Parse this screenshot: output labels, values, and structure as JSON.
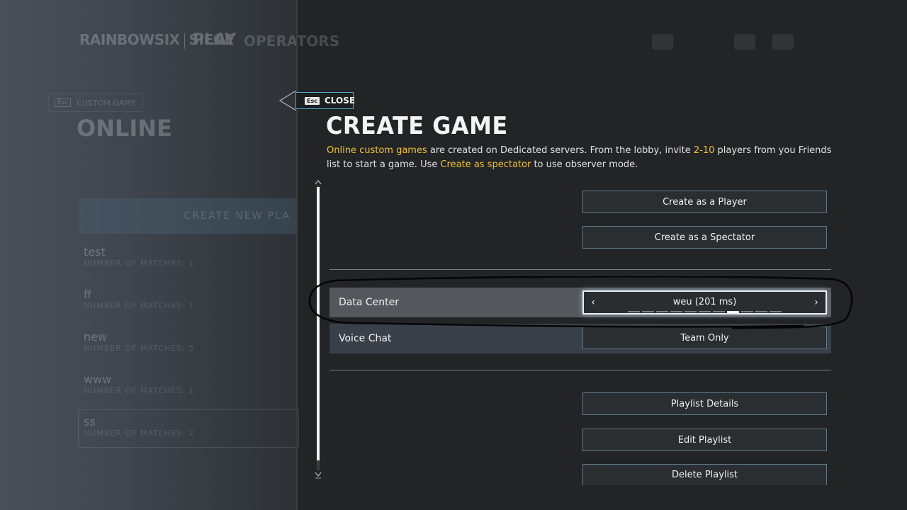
{
  "background": {
    "logo": "RAINBOW SIX | SIEGE",
    "logo_left": "RAINBOWSIX",
    "logo_right": "SIEGE",
    "nav_play": "PLAY",
    "nav_operators": "OPERATORS",
    "esc_key": "Esc",
    "back_label": "CUSTOM GAME",
    "page_title": "ONLINE",
    "create_new_label": "CREATE NEW PLA",
    "playlists": [
      {
        "name": "test",
        "matches": "NUMBER OF MATCHES: 1"
      },
      {
        "name": "ff",
        "matches": "NUMBER OF MATCHES: 1"
      },
      {
        "name": "new",
        "matches": "NUMBER OF MATCHES: 5"
      },
      {
        "name": "www",
        "matches": "NUMBER OF MATCHES: 1"
      },
      {
        "name": "ss",
        "matches": "NUMBER OF MATCHES: 2"
      }
    ]
  },
  "dialog": {
    "close_key": "Esc",
    "close_label": "CLOSE",
    "title": "CREATE GAME",
    "description": {
      "hl1": "Online custom games",
      "t1": " are created on Dedicated servers. From the lobby, invite ",
      "hl2": "2-10",
      "t2": " players from you Friends list to start a game. Use ",
      "hl3": "Create as spectator",
      "t3": " to use observer mode."
    },
    "buttons": {
      "create_player": "Create as a Player",
      "create_spectator": "Create as a Spectator",
      "playlist_details": "Playlist Details",
      "edit_playlist": "Edit Playlist",
      "delete_playlist": "Delete Playlist"
    },
    "data_center": {
      "label": "Data Center",
      "value": "weu (201 ms)",
      "option_count": 11,
      "selected_index": 7
    },
    "voice_chat": {
      "label": "Voice Chat",
      "value": "Team Only"
    }
  },
  "colors": {
    "highlight": "#f2c232",
    "accent_border": "#4fa8c8",
    "panel_bg": "#222426"
  }
}
